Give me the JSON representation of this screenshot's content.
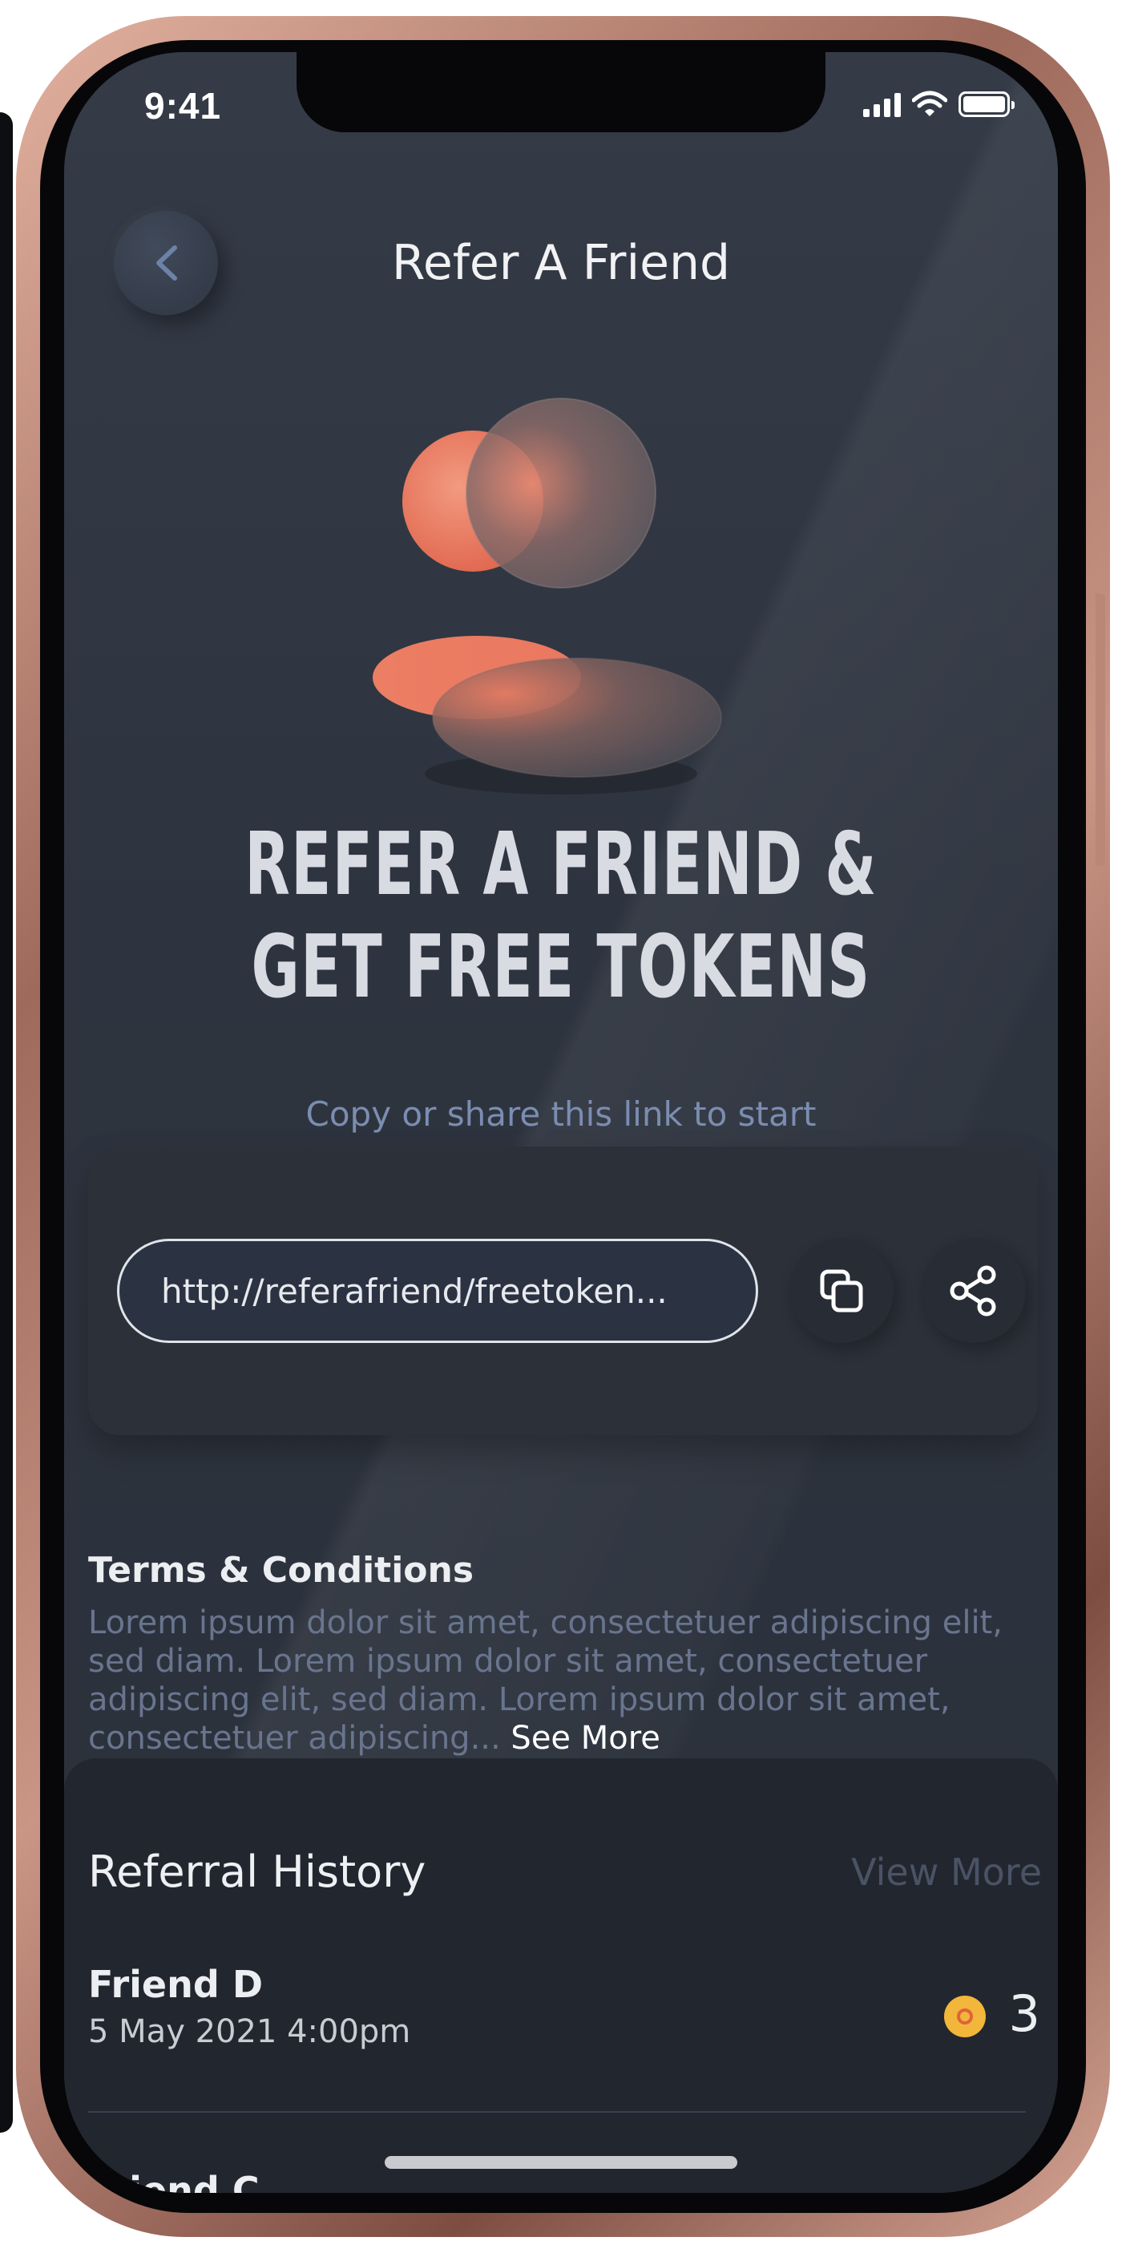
{
  "status_bar": {
    "time": "9:41"
  },
  "header": {
    "title": "Refer A Friend",
    "back_icon": "chevron-left-icon"
  },
  "hero": {
    "headline_line1": "REFER A FRIEND &",
    "headline_line2": "GET FREE TOKENS",
    "subtitle": "Copy or share this link to start"
  },
  "referral_link": {
    "value": "http://referafriend/freetoken...",
    "copy_icon": "copy-icon",
    "share_icon": "share-icon"
  },
  "terms": {
    "title": "Terms & Conditions",
    "body": "Lorem ipsum dolor sit amet, consectetuer adipiscing elit, sed diam. Lorem ipsum dolor sit amet, consectetuer adipiscing elit, sed diam. Lorem ipsum dolor sit amet, consectetuer adipiscing...",
    "see_more": " See More"
  },
  "referral_history": {
    "title": "Referral History",
    "view_more": "View More",
    "items": [
      {
        "name": "Friend D",
        "date": "5 May 2021 4:00pm",
        "tokens": "3"
      },
      {
        "name": "Friend C"
      }
    ]
  },
  "colors": {
    "accent": "#e8735b",
    "background": "#2e343f",
    "token": "#f2b63a"
  }
}
